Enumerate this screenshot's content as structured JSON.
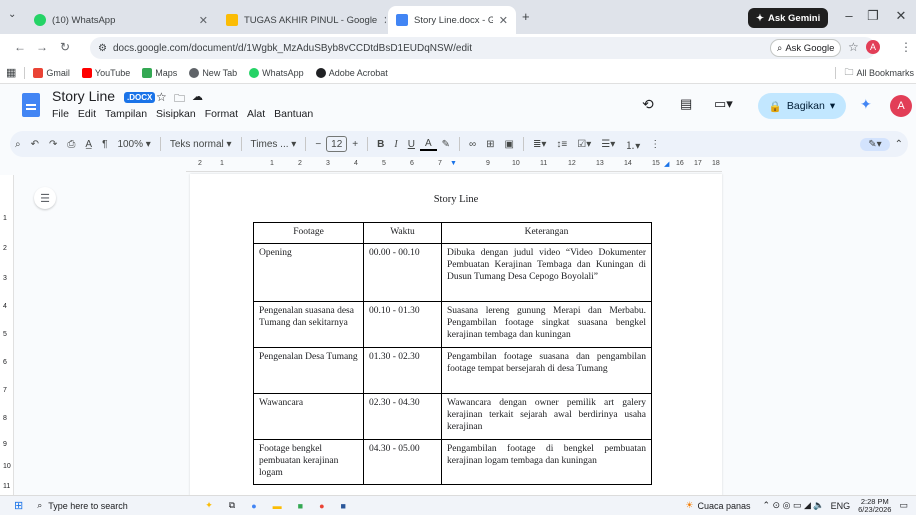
{
  "browser": {
    "tabs": [
      {
        "title": "(10) WhatsApp",
        "color": "#25d366"
      },
      {
        "title": "TUGAS AKHIR PINUL - Google",
        "color": "#fbbc04"
      },
      {
        "title": "Story Line.docx - Google Doku",
        "color": "#4285f4"
      }
    ],
    "gemini_label": "Ask Gemini",
    "url": "docs.google.com/document/d/1Wgbk_MzAduSByb8vCCDtdBsD1EUDqNSW/edit",
    "ask_google": "Ask Google",
    "avatar_letter": "A",
    "bookmarks": [
      {
        "label": "Gmail",
        "color": "#ea4335"
      },
      {
        "label": "YouTube",
        "color": "#ff0000"
      },
      {
        "label": "Maps",
        "color": "#34a853"
      },
      {
        "label": "New Tab",
        "color": "#5f6368"
      },
      {
        "label": "WhatsApp",
        "color": "#25d366"
      },
      {
        "label": "Adobe Acrobat",
        "color": "#202124"
      }
    ],
    "all_bookmarks": "All Bookmarks"
  },
  "doc": {
    "title": "Story Line",
    "badge": ".DOCX",
    "menu": [
      "File",
      "Edit",
      "Tampilan",
      "Sisipkan",
      "Format",
      "Alat",
      "Bantuan"
    ],
    "share_label": "Bagikan",
    "avatar_letter": "A"
  },
  "toolbar": {
    "zoom": "100%",
    "style": "Teks normal",
    "font": "Times ...",
    "font_size": "12"
  },
  "ruler": [
    "2",
    "1",
    "1",
    "2",
    "3",
    "4",
    "5",
    "6",
    "7",
    "9",
    "10",
    "11",
    "12",
    "13",
    "14",
    "15",
    "16",
    "17",
    "18"
  ],
  "vruler": [
    "1",
    "2",
    "3",
    "4",
    "5",
    "6",
    "7",
    "8",
    "9",
    "10",
    "11"
  ],
  "content": {
    "heading": "Story Line",
    "columns": [
      "Footage",
      "Waktu",
      "Keterangan"
    ],
    "rows": [
      {
        "footage": "Opening",
        "waktu": "00.00 - 00.10",
        "keterangan": "Dibuka dengan judul video “Video Dokumenter Pembuatan Kerajinan Tembaga dan Kuningan di Dusun Tumang Desa Cepogo Boyolali”"
      },
      {
        "footage": "Pengenalan suasana desa Tumang dan sekitarnya",
        "waktu": "00.10 - 01.30",
        "keterangan": "Suasana lereng gunung Merapi dan Merbabu. Pengambilan footage singkat suasana bengkel kerajinan tembaga dan kuningan"
      },
      {
        "footage": "Pengenalan Desa Tumang",
        "waktu": "01.30 - 02.30",
        "keterangan": "Pengambilan footage suasana dan pengambilan footage tempat bersejarah di desa Tumang"
      },
      {
        "footage": "Wawancara",
        "waktu": "02.30 - 04.30",
        "keterangan": "Wawancara dengan owner pemilik art galery kerajinan terkait sejarah awal berdirinya usaha kerajinan"
      },
      {
        "footage": "Footage bengkel pembuatan kerajinan logam",
        "waktu": "04.30 - 05.00",
        "keterangan": "Pengambilan footage di bengkel pembuatan kerajinan logam tembaga dan kuningan"
      }
    ]
  },
  "taskbar": {
    "search_placeholder": "Type here to search",
    "weather": "Cuaca panas",
    "lang": "ENG",
    "time": "2:28 PM",
    "date": "6/23/2026"
  }
}
